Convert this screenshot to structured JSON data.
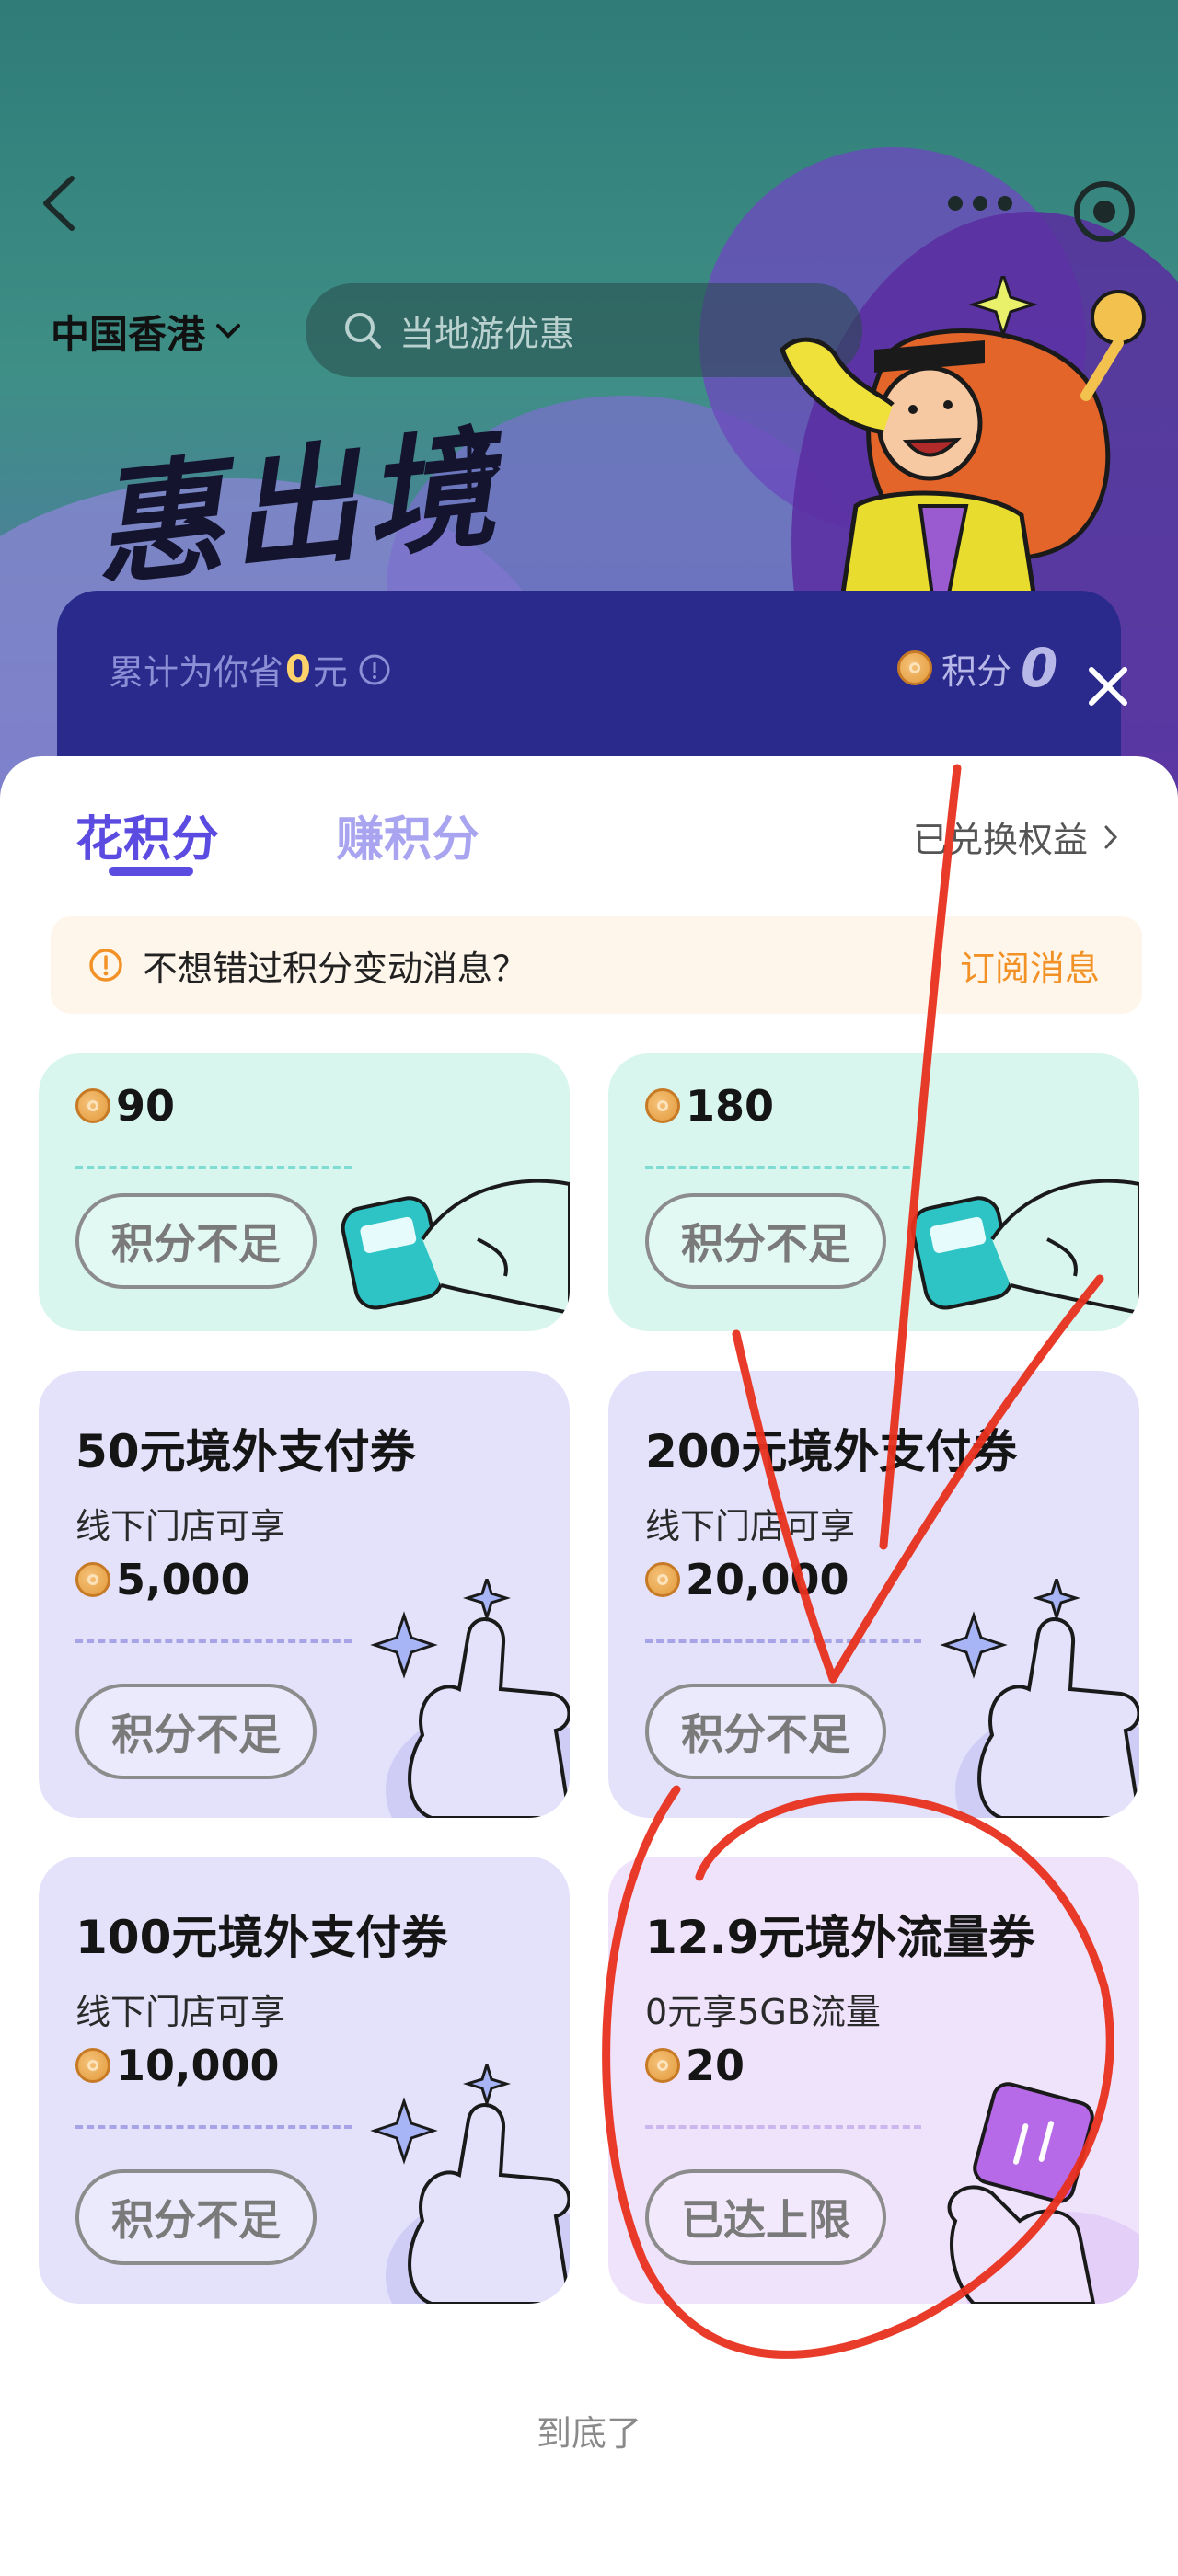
{
  "header": {
    "region": "中国香港",
    "search_placeholder": "当地游优惠",
    "hero_title": "惠出境"
  },
  "savings": {
    "prefix": "累计为你省",
    "amount": "0",
    "suffix": "元",
    "points_label": "积分",
    "points_value": "0"
  },
  "tabs": {
    "spend": "花积分",
    "earn": "赚积分",
    "redeemed": "已兑换权益"
  },
  "notice": {
    "text": "不想错过积分变动消息？",
    "action": "订阅消息"
  },
  "coupons": [
    {
      "title": "",
      "subtitle": "",
      "cost": "90",
      "button": "积分不足",
      "style": "teal"
    },
    {
      "title": "",
      "subtitle": "",
      "cost": "180",
      "button": "积分不足",
      "style": "teal"
    },
    {
      "title": "50元境外支付券",
      "subtitle": "线下门店可享",
      "cost": "5,000",
      "button": "积分不足",
      "style": "lavender"
    },
    {
      "title": "200元境外支付券",
      "subtitle": "线下门店可享",
      "cost": "20,000",
      "button": "积分不足",
      "style": "lavender"
    },
    {
      "title": "100元境外支付券",
      "subtitle": "线下门店可享",
      "cost": "10,000",
      "button": "积分不足",
      "style": "lavender"
    },
    {
      "title": "12.9元境外流量券",
      "subtitle": "0元享5GB流量",
      "cost": "20",
      "button": "已达上限",
      "style": "pink"
    }
  ],
  "footer": {
    "end_text": "到底了"
  },
  "colors": {
    "accent": "#5b4be0",
    "notice_action": "#f29226",
    "annotation_red": "#e8301d"
  }
}
